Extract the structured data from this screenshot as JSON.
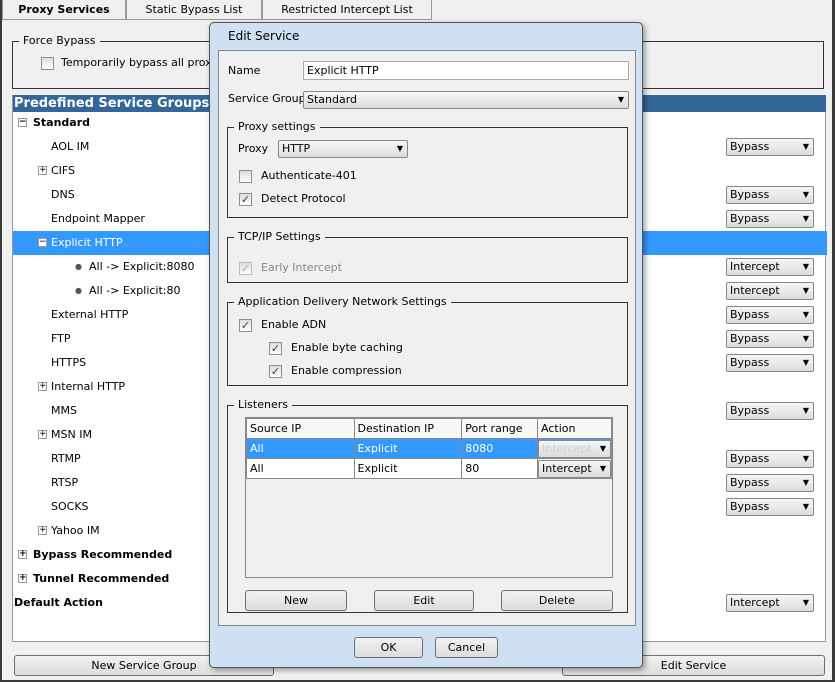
{
  "tabs": [
    "Proxy Services",
    "Static Bypass List",
    "Restricted Intercept List"
  ],
  "force_bypass": {
    "legend": "Force Bypass",
    "checkbox_label": "Temporarily bypass all proxy se",
    "checked": false
  },
  "groups_header": "Predefined Service Groups",
  "tree": [
    {
      "label": "Standard",
      "level": 0,
      "bold": true,
      "expander": "-"
    },
    {
      "label": "AOL IM",
      "level": 1,
      "action": "Bypass"
    },
    {
      "label": "CIFS",
      "level": 1,
      "expander": "+"
    },
    {
      "label": "DNS",
      "level": 1,
      "action": "Bypass"
    },
    {
      "label": "Endpoint Mapper",
      "level": 1,
      "action": "Bypass"
    },
    {
      "label": "Explicit HTTP",
      "level": 1,
      "expander": "-",
      "selected": true
    },
    {
      "label": "All -> Explicit:8080",
      "level": 2,
      "action": "Intercept"
    },
    {
      "label": "All -> Explicit:80",
      "level": 2,
      "action": "Intercept"
    },
    {
      "label": "External HTTP",
      "level": 1,
      "action": "Bypass"
    },
    {
      "label": "FTP",
      "level": 1,
      "action": "Bypass"
    },
    {
      "label": "HTTPS",
      "level": 1,
      "action": "Bypass"
    },
    {
      "label": "Internal HTTP",
      "level": 1,
      "expander": "+"
    },
    {
      "label": "MMS",
      "level": 1,
      "action": "Bypass"
    },
    {
      "label": "MSN IM",
      "level": 1,
      "expander": "+"
    },
    {
      "label": "RTMP",
      "level": 1,
      "action": "Bypass"
    },
    {
      "label": "RTSP",
      "level": 1,
      "action": "Bypass"
    },
    {
      "label": "SOCKS",
      "level": 1,
      "action": "Bypass"
    },
    {
      "label": "Yahoo IM",
      "level": 1,
      "expander": "+"
    },
    {
      "label": "Bypass Recommended",
      "level": 0,
      "bold": true,
      "expander": "+"
    },
    {
      "label": "Tunnel Recommended",
      "level": 0,
      "bold": true,
      "expander": "+"
    },
    {
      "label": "Default Action",
      "level": -1,
      "bold": true,
      "action": "Intercept"
    }
  ],
  "bottom_buttons": {
    "new_group": "New Service Group",
    "edit_service": "Edit Service"
  },
  "dialog": {
    "title": "Edit Service",
    "name_label": "Name",
    "name_value": "Explicit HTTP",
    "group_label": "Service Group",
    "group_value": "Standard",
    "proxy_settings": {
      "legend": "Proxy settings",
      "proxy_label": "Proxy",
      "proxy_value": "HTTP",
      "auth_label": "Authenticate-401",
      "auth_checked": false,
      "detect_label": "Detect Protocol",
      "detect_checked": true
    },
    "tcpip": {
      "legend": "TCP/IP Settings",
      "early_label": "Early Intercept",
      "early_checked": true
    },
    "adn": {
      "legend": "Application Delivery Network Settings",
      "enable_label": "Enable ADN",
      "byte_label": "Enable byte caching",
      "comp_label": "Enable compression"
    },
    "listeners": {
      "legend": "Listeners",
      "columns": [
        "Source IP",
        "Destination IP",
        "Port range",
        "Action"
      ],
      "rows": [
        [
          "All",
          "Explicit",
          "8080",
          "Intercept"
        ],
        [
          "All",
          "Explicit",
          "80",
          "Intercept"
        ]
      ],
      "new": "New",
      "edit": "Edit",
      "delete": "Delete"
    },
    "ok": "OK",
    "cancel": "Cancel"
  },
  "colors": {
    "selection": "#3399ff",
    "header": "#336699"
  }
}
